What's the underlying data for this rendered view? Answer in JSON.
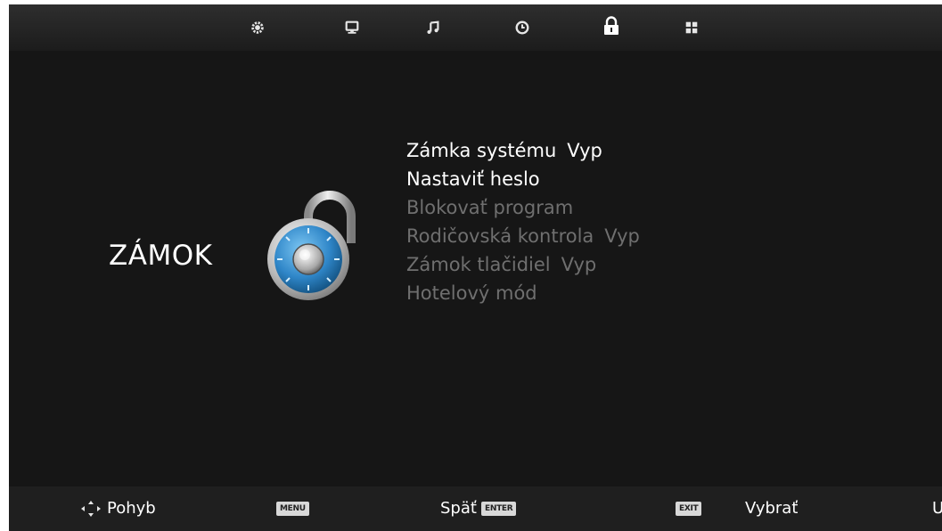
{
  "top_tabs": [
    {
      "name": "picture-settings-icon",
      "active": false
    },
    {
      "name": "screen-icon",
      "active": false
    },
    {
      "name": "music-note-icon",
      "active": false
    },
    {
      "name": "clock-icon",
      "active": false
    },
    {
      "name": "padlock-icon",
      "active": true
    },
    {
      "name": "apps-grid-icon",
      "active": false
    }
  ],
  "section": {
    "title": "ZÁMOK"
  },
  "menu": {
    "items": [
      {
        "label": "Zámka systému",
        "value": "Vyp",
        "enabled": true
      },
      {
        "label": "Nastaviť heslo",
        "value": "",
        "enabled": true
      },
      {
        "label": "Blokovať program",
        "value": "",
        "enabled": false
      },
      {
        "label": "Rodičovská kontrola",
        "value": "Vyp",
        "enabled": false
      },
      {
        "label": "Zámok tlačidiel",
        "value": "Vyp",
        "enabled": false
      },
      {
        "label": "Hotelový mód",
        "value": "",
        "enabled": false
      }
    ]
  },
  "bottom": {
    "move_label": "Pohyb",
    "menu_key": "MENU",
    "back_label": "Späť",
    "enter_key": "ENTER",
    "exit_key": "EXIT",
    "select_label": "Vybrať",
    "cut_label": "U"
  },
  "colors": {
    "background": "#161616",
    "active_text": "#ffffff",
    "disabled_text": "#6f6f6f",
    "lock_blue": "#2f86c8"
  }
}
